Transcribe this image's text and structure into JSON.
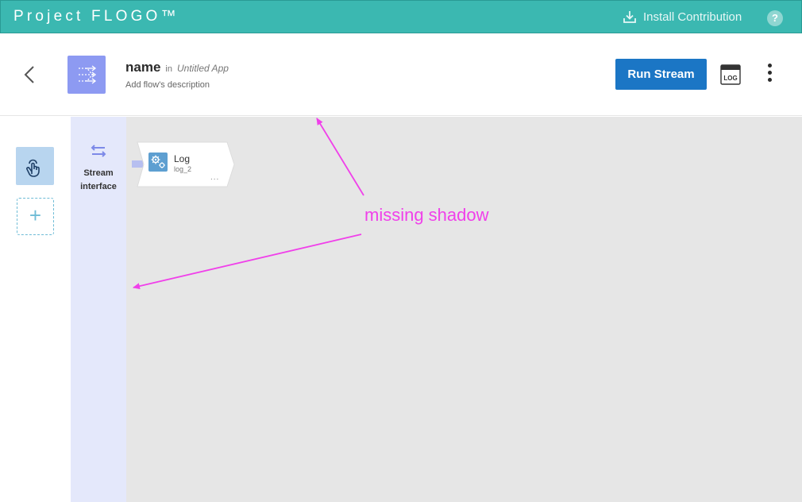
{
  "topbar": {
    "brand": "Project FLOGO™",
    "install_label": "Install Contribution",
    "help_label": "?"
  },
  "header": {
    "flow_name": "name",
    "in_label": "in",
    "app_name": "Untitled App",
    "description": "Add flow's description",
    "run_label": "Run Stream",
    "log_label": "LOG"
  },
  "rail": {
    "add_label": "+"
  },
  "stream": {
    "label": "Stream interface"
  },
  "tile": {
    "name": "Log",
    "id": "log_2",
    "more": "..."
  },
  "annotation": {
    "text": "missing shadow",
    "color": "#f040ea"
  },
  "colors": {
    "topbar": "#3bb8b1",
    "primary_button": "#1b76c5",
    "flow_icon": "#8d9af2",
    "stream_column": "#e4e8fb",
    "canvas": "#e6e6e6"
  }
}
